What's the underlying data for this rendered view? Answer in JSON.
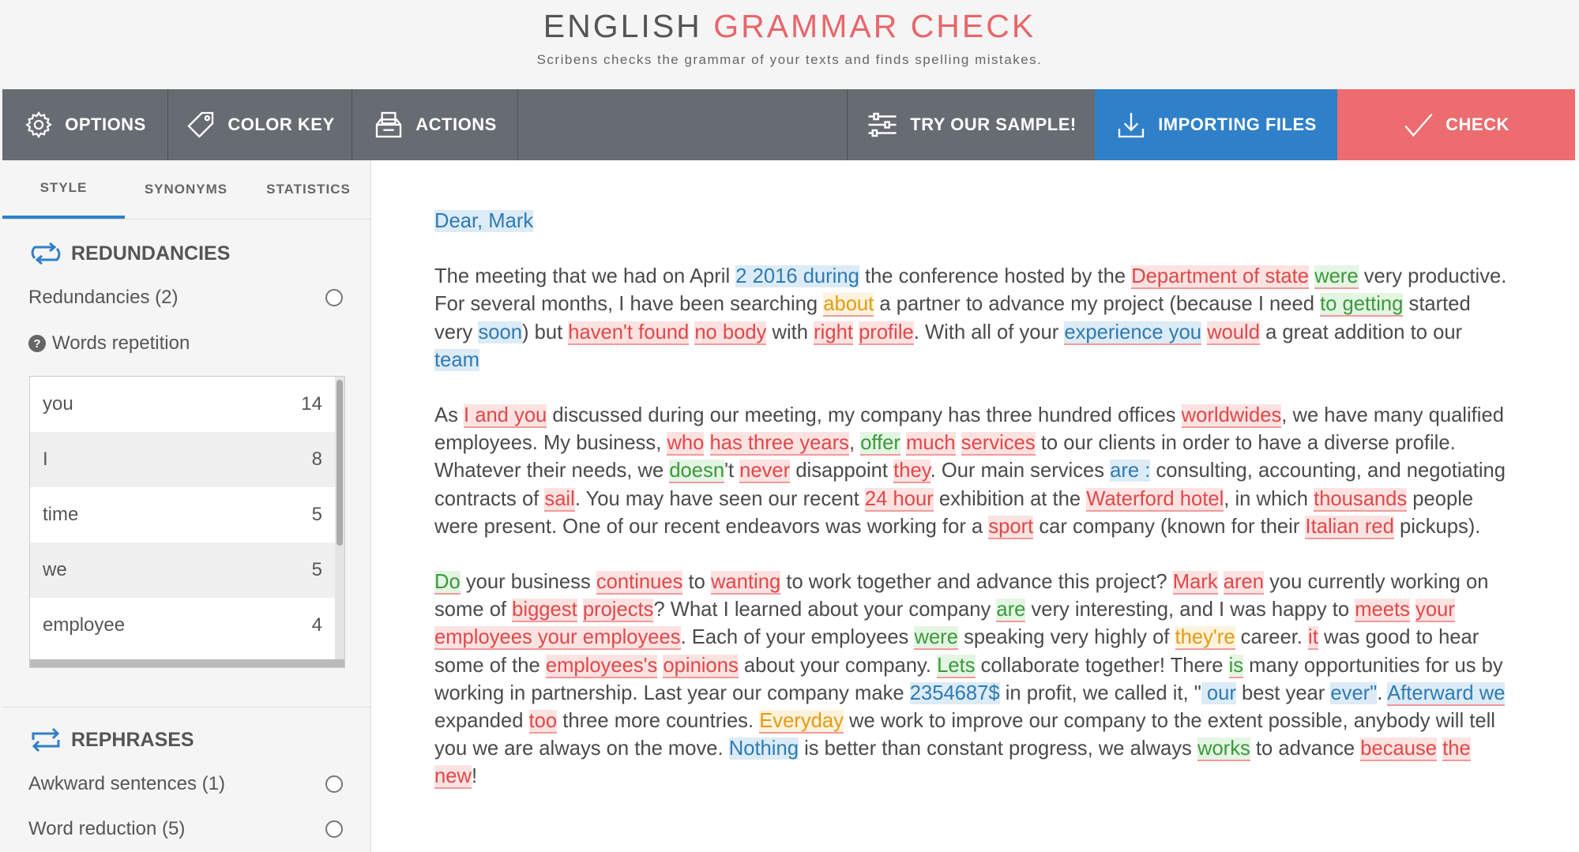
{
  "header": {
    "title_part1": "ENGLISH",
    "title_part2": "GRAMMAR CHECK",
    "subtitle": "Scribens checks the grammar of your texts and finds spelling mistakes."
  },
  "toolbar": {
    "options": "OPTIONS",
    "color_key": "COLOR KEY",
    "actions": "ACTIONS",
    "sample": "TRY OUR SAMPLE!",
    "import": "IMPORTING FILES",
    "check": "CHECK"
  },
  "sidebar": {
    "tabs": [
      "STYLE",
      "SYNONYMS",
      "STATISTICS"
    ],
    "redundancies": {
      "title": "REDUNDANCIES",
      "item": "Redundancies (2)",
      "repetition_label": "Words repetition",
      "words": [
        {
          "word": "you",
          "count": "14"
        },
        {
          "word": "I",
          "count": "8"
        },
        {
          "word": "time",
          "count": "5"
        },
        {
          "word": "we",
          "count": "5"
        },
        {
          "word": "employee",
          "count": "4"
        }
      ]
    },
    "rephrases": {
      "title": "REPHRASES",
      "items": [
        "Awkward sentences (1)",
        "Word reduction (5)"
      ]
    }
  },
  "doc": {
    "greeting": "Dear, Mark",
    "p1": [
      {
        "t": "The meeting that we had on April "
      },
      {
        "t": "2 2016 during",
        "c": "b"
      },
      {
        "t": " the conference hosted by the "
      },
      {
        "t": "Department of state",
        "c": "r"
      },
      {
        "t": " "
      },
      {
        "t": "were",
        "c": "g"
      },
      {
        "t": " very productive. For several months, I have been searching "
      },
      {
        "t": "about",
        "c": "o"
      },
      {
        "t": " a partner to advance my project (because I need "
      },
      {
        "t": "to getting",
        "c": "g"
      },
      {
        "t": " started very "
      },
      {
        "t": "soon",
        "c": "b"
      },
      {
        "t": ") but "
      },
      {
        "t": "haven't found",
        "c": "r"
      },
      {
        "t": " "
      },
      {
        "t": "no body",
        "c": "r"
      },
      {
        "t": " with "
      },
      {
        "t": "right",
        "c": "r"
      },
      {
        "t": " "
      },
      {
        "t": "profile",
        "c": "r"
      },
      {
        "t": ". With all of your "
      },
      {
        "t": "experience you",
        "c": "bu"
      },
      {
        "t": " "
      },
      {
        "t": "would",
        "c": "r"
      },
      {
        "t": " a great addition to our "
      },
      {
        "t": "team",
        "c": "b"
      }
    ],
    "p2": [
      {
        "t": "As "
      },
      {
        "t": "I and you",
        "c": "r"
      },
      {
        "t": " discussed during our meeting, my company has three hundred offices "
      },
      {
        "t": "worldwides",
        "c": "r"
      },
      {
        "t": ", we have many qualified employees. My business, "
      },
      {
        "t": "who",
        "c": "r"
      },
      {
        "t": " "
      },
      {
        "t": "has three years",
        "c": "r"
      },
      {
        "t": ", "
      },
      {
        "t": "offer",
        "c": "g"
      },
      {
        "t": " "
      },
      {
        "t": "much",
        "c": "r"
      },
      {
        "t": " "
      },
      {
        "t": "services",
        "c": "r"
      },
      {
        "t": " to our clients in order to have a diverse profile. Whatever their needs, we "
      },
      {
        "t": "doesn",
        "c": "g"
      },
      {
        "t": "'t "
      },
      {
        "t": "never",
        "c": "r"
      },
      {
        "t": " disappoint "
      },
      {
        "t": "they",
        "c": "r"
      },
      {
        "t": ". Our main services "
      },
      {
        "t": "are :",
        "c": "b"
      },
      {
        "t": " consulting, accounting, and negotiating contracts of "
      },
      {
        "t": "sail",
        "c": "r"
      },
      {
        "t": ". You may have seen our recent "
      },
      {
        "t": "24 hour",
        "c": "r"
      },
      {
        "t": " exhibition at the "
      },
      {
        "t": "Waterford hotel",
        "c": "r"
      },
      {
        "t": ", in which "
      },
      {
        "t": "thousands",
        "c": "r"
      },
      {
        "t": " people were present. One of our recent endeavors was working for a "
      },
      {
        "t": "sport",
        "c": "r"
      },
      {
        "t": " car company (known for their "
      },
      {
        "t": "Italian red",
        "c": "r"
      },
      {
        "t": " pickups)."
      }
    ],
    "p3": [
      {
        "t": "Do",
        "c": "g"
      },
      {
        "t": " your business "
      },
      {
        "t": "continues",
        "c": "r"
      },
      {
        "t": " to "
      },
      {
        "t": "wanting",
        "c": "r"
      },
      {
        "t": " to work together and advance this project? "
      },
      {
        "t": "Mark",
        "c": "r"
      },
      {
        "t": " "
      },
      {
        "t": "aren",
        "c": "r"
      },
      {
        "t": " you currently working on some of "
      },
      {
        "t": "biggest",
        "c": "r"
      },
      {
        "t": " "
      },
      {
        "t": "projects",
        "c": "r"
      },
      {
        "t": "? What I learned about your company "
      },
      {
        "t": "are",
        "c": "g"
      },
      {
        "t": " very interesting, and I was happy to "
      },
      {
        "t": "meets",
        "c": "r"
      },
      {
        "t": " "
      },
      {
        "t": "your employees your employees",
        "c": "r"
      },
      {
        "t": ". Each of your employees "
      },
      {
        "t": "were",
        "c": "g"
      },
      {
        "t": " speaking very highly of "
      },
      {
        "t": "they're",
        "c": "o"
      },
      {
        "t": " career. "
      },
      {
        "t": "it",
        "c": "r"
      },
      {
        "t": " was good to hear some of the "
      },
      {
        "t": "employees's",
        "c": "r"
      },
      {
        "t": " "
      },
      {
        "t": "opinions",
        "c": "r"
      },
      {
        "t": " about your company. "
      },
      {
        "t": "Lets",
        "c": "g"
      },
      {
        "t": " collaborate together! There "
      },
      {
        "t": "is",
        "c": "g"
      },
      {
        "t": " many opportunities for us by working in partnership. Last year our company make "
      },
      {
        "t": "2354687$",
        "c": "b"
      },
      {
        "t": " in profit, we called it, \""
      },
      {
        "t": " our",
        "c": "b"
      },
      {
        "t": " best year "
      },
      {
        "t": "ever\"",
        "c": "b"
      },
      {
        "t": ". "
      },
      {
        "t": "Afterward we",
        "c": "bu"
      },
      {
        "t": " expanded "
      },
      {
        "t": "too",
        "c": "r"
      },
      {
        "t": " three more countries. "
      },
      {
        "t": "Everyday",
        "c": "o"
      },
      {
        "t": " we work to improve our company to the extent possible, anybody will tell you we are always on the move. "
      },
      {
        "t": "  Nothing",
        "c": "b"
      },
      {
        "t": " is better than constant progress, we always "
      },
      {
        "t": "works",
        "c": "g"
      },
      {
        "t": " to advance "
      },
      {
        "t": "because",
        "c": "r"
      },
      {
        "t": " "
      },
      {
        "t": "the",
        "c": "r"
      },
      {
        "t": " "
      },
      {
        "t": "new",
        "c": "r"
      },
      {
        "t": "!"
      }
    ]
  }
}
